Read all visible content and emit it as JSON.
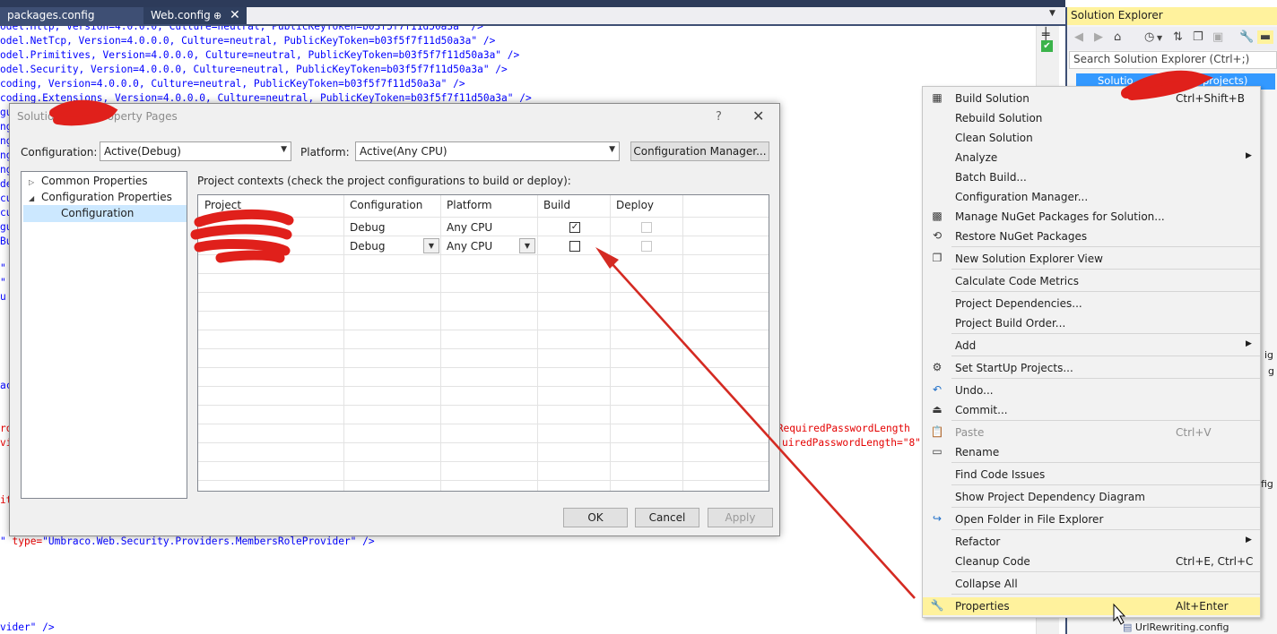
{
  "tabs": [
    {
      "label": "packages.config"
    },
    {
      "label": "Web.config"
    }
  ],
  "tab_pin_glyph": "⊕",
  "tab_close_glyph": "✕",
  "editor": {
    "lines": [
      {
        "p1": "odel.Http, Version=4.0.0.0, Culture=neutral, PublicKeyToken=b03f5f7f11d50a3a\" />"
      },
      {
        "p1": "odel.NetTcp, Version=4.0.0.0, Culture=neutral, PublicKeyToken=b03f5f7f11d50a3a\" />"
      },
      {
        "p1": "odel.Primitives, Version=4.0.0.0, Culture=neutral, PublicKeyToken=b03f5f7f11d50a3a\" />"
      },
      {
        "p1": "odel.Security, Version=4.0.0.0, Culture=neutral, PublicKeyToken=b03f5f7f11d50a3a\" />"
      },
      {
        "p1": "coding, Version=4.0.0.0, Culture=neutral, PublicKeyToken=b03f5f7f11d50a3a\" />"
      },
      {
        "p1": "coding.Extensions, Version=4.0.0.0, Culture=neutral, PublicKeyToken=b03f5f7f11d50a3a\" />"
      }
    ],
    "left_fragments": [
      "gu",
      "ng",
      "ng",
      "ng",
      "ng",
      "de",
      "cu",
      "cu",
      "gu",
      "Bu",
      "\"",
      "\"",
      "u",
      "ac",
      "ro",
      "vi",
      "it"
    ],
    "right_fragment_1": "nRequiredPasswordLength",
    "right_fragment_2": "uiredPasswordLength=\"8\"",
    "role_line_a": "\" ",
    "role_line_b": "type=",
    "role_line_c": "\"Umbraco.Web.Security.Providers.MembersRoleProvider\"",
    "role_line_d": " />",
    "last_line": "vider\" />"
  },
  "solution_explorer": {
    "title": "Solution Explorer",
    "search_placeholder": "Search Solution Explorer (Ctrl+;)",
    "root_label": "Solutio",
    "root_suffix": "2 projects)",
    "frag_1": "ig",
    "frag_2": "g",
    "frag_3": "fig",
    "bottom_item": "UrlRewriting.config"
  },
  "dialog": {
    "title_a": "Solution",
    "title_b": "Property Pages",
    "help": "?",
    "close": "✕",
    "configuration_label": "Configuration:",
    "configuration_value": "Active(Debug)",
    "platform_label": "Platform:",
    "platform_value": "Active(Any CPU)",
    "config_manager_button": "Configuration Manager...",
    "tree": [
      {
        "label": "Common Properties",
        "twisty": "▷"
      },
      {
        "label": "Configuration Properties",
        "twisty": "◢"
      },
      {
        "label": "Configuration",
        "twisty": ""
      }
    ],
    "contexts_label": "Project contexts (check the project configurations to build or deploy):",
    "columns": [
      "Project",
      "Configuration",
      "Platform",
      "Build",
      "Deploy"
    ],
    "rows": [
      {
        "configuration": "Debug",
        "platform": "Any CPU",
        "build": true,
        "deploy": false
      },
      {
        "configuration": "Debug",
        "platform": "Any CPU",
        "build": false,
        "deploy": false
      }
    ],
    "ok": "OK",
    "cancel": "Cancel",
    "apply": "Apply"
  },
  "context_menu": {
    "items": [
      {
        "label": "Build Solution",
        "shortcut": "Ctrl+Shift+B",
        "icon": "build-icon"
      },
      {
        "label": "Rebuild Solution",
        "shortcut": ""
      },
      {
        "label": "Clean Solution",
        "shortcut": ""
      },
      {
        "label": "Analyze",
        "shortcut": "",
        "submenu": true
      },
      {
        "label": "Batch Build...",
        "shortcut": ""
      },
      {
        "label": "Configuration Manager...",
        "shortcut": ""
      },
      {
        "label": "Manage NuGet Packages for Solution...",
        "shortcut": "",
        "icon": "nuget-icon"
      },
      {
        "label": "Restore NuGet Packages",
        "shortcut": "",
        "icon": "restore-icon"
      },
      {
        "label": "New Solution Explorer View",
        "shortcut": "",
        "icon": "new-view-icon"
      },
      {
        "label": "Calculate Code Metrics",
        "shortcut": ""
      },
      {
        "label": "Project Dependencies...",
        "shortcut": ""
      },
      {
        "label": "Project Build Order...",
        "shortcut": ""
      },
      {
        "label": "Add",
        "shortcut": "",
        "submenu": true
      },
      {
        "label": "Set StartUp Projects...",
        "shortcut": "",
        "icon": "gear-icon"
      },
      {
        "label": "Undo...",
        "shortcut": "",
        "icon": "undo-icon"
      },
      {
        "label": "Commit...",
        "shortcut": "",
        "icon": "commit-icon"
      },
      {
        "label": "Paste",
        "shortcut": "Ctrl+V",
        "icon": "paste-icon",
        "disabled": true
      },
      {
        "label": "Rename",
        "shortcut": "",
        "icon": "rename-icon"
      },
      {
        "label": "Find Code Issues",
        "shortcut": ""
      },
      {
        "label": "Show Project Dependency Diagram",
        "shortcut": ""
      },
      {
        "label": "Open Folder in File Explorer",
        "shortcut": "",
        "icon": "open-folder-icon"
      },
      {
        "label": "Refactor",
        "shortcut": "",
        "submenu": true
      },
      {
        "label": "Cleanup Code",
        "shortcut": "Ctrl+E, Ctrl+C"
      },
      {
        "label": "Collapse All",
        "shortcut": ""
      },
      {
        "label": "Properties",
        "shortcut": "Alt+Enter",
        "icon": "wrench-icon"
      }
    ]
  },
  "colors": {
    "accent_tab": "#3e4f74",
    "selection_yellow": "#fff29d",
    "annotation_red": "#e0201b",
    "tree_selected": "#3399ff"
  }
}
